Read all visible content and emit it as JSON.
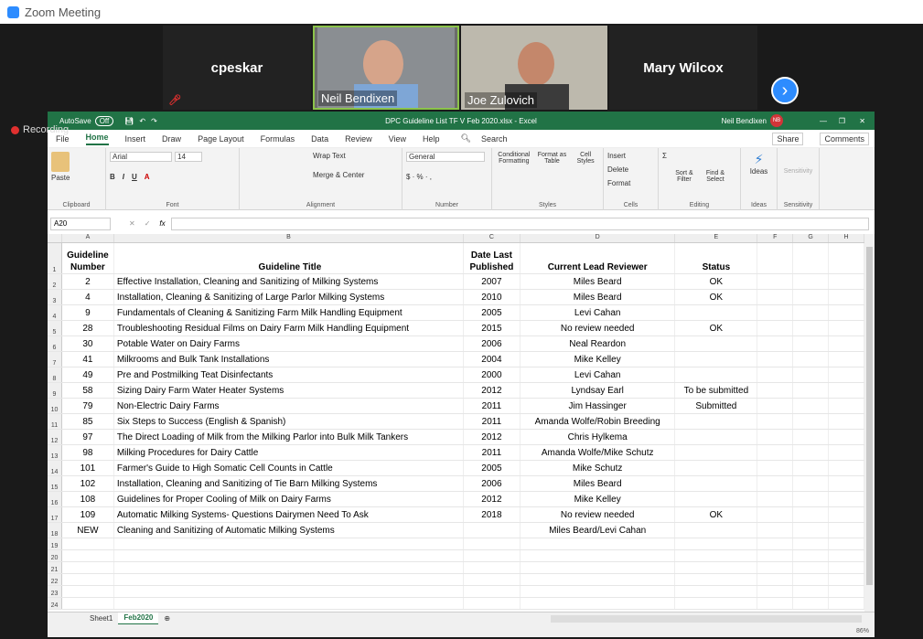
{
  "zoom": {
    "window_title": "Zoom Meeting",
    "participants": [
      {
        "name": "cpeskar",
        "muted": true,
        "video": false
      },
      {
        "name": "Neil Bendixen",
        "muted": false,
        "video": true
      },
      {
        "name": "Joe Zulovich",
        "muted": true,
        "video": true
      },
      {
        "name": "Mary Wilcox",
        "muted": false,
        "video": false
      }
    ],
    "recording_label": "Recording"
  },
  "excel": {
    "autosave": "AutoSave",
    "autosave_state": "Off",
    "file_title": "DPC Guideline List TF V Feb 2020.xlsx  -  Excel",
    "user": "Neil Bendixen",
    "user_initials": "NB",
    "menu": [
      "File",
      "Home",
      "Insert",
      "Draw",
      "Page Layout",
      "Formulas",
      "Data",
      "Review",
      "View",
      "Help"
    ],
    "search": "Search",
    "share": "Share",
    "comments": "Comments",
    "font_name": "Arial",
    "font_size": "14",
    "number_format": "General",
    "name_box": "A20",
    "ribbon_groups": [
      "Clipboard",
      "Font",
      "Alignment",
      "Number",
      "Styles",
      "Cells",
      "Editing",
      "Ideas",
      "Sensitivity"
    ],
    "ribbon_buttons": {
      "paste": "Paste",
      "wrap_text": "Wrap Text",
      "merge_center": "Merge & Center",
      "conditional": "Conditional Formatting",
      "format_table": "Format as Table",
      "cell_styles": "Cell Styles",
      "insert": "Insert",
      "delete": "Delete",
      "format": "Format",
      "sort": "Sort & Filter",
      "find": "Find & Select",
      "ideas": "Ideas",
      "sensitivity": "Sensitivity"
    },
    "columns": [
      "A",
      "B",
      "C",
      "D",
      "E",
      "F",
      "G",
      "H"
    ],
    "header": {
      "a": "Guideline Number",
      "b": "Guideline Title",
      "c": "Date Last Published",
      "d": "Current Lead Reviewer",
      "e": "Status"
    },
    "rows": [
      {
        "n": "2",
        "t": "Effective Installation, Cleaning and Sanitizing of Milking Systems",
        "y": "2007",
        "r": "Miles Beard",
        "s": "OK"
      },
      {
        "n": "4",
        "t": "Installation, Cleaning & Sanitizing of Large Parlor Milking Systems",
        "y": "2010",
        "r": "Miles Beard",
        "s": "OK"
      },
      {
        "n": "9",
        "t": "Fundamentals of Cleaning & Sanitizing Farm Milk Handling Equipment",
        "y": "2005",
        "r": "Levi Cahan",
        "s": ""
      },
      {
        "n": "28",
        "t": "Troubleshooting Residual Films on Dairy Farm Milk Handling Equipment",
        "y": "2015",
        "r": "No review needed",
        "s": "OK"
      },
      {
        "n": "30",
        "t": "Potable Water on Dairy Farms",
        "y": "2006",
        "r": "Neal Reardon",
        "s": ""
      },
      {
        "n": "41",
        "t": "Milkrooms and Bulk Tank Installations",
        "y": "2004",
        "r": "Mike Kelley",
        "s": ""
      },
      {
        "n": "49",
        "t": "Pre and Postmilking Teat Disinfectants",
        "y": "2000",
        "r": "Levi Cahan",
        "s": ""
      },
      {
        "n": "58",
        "t": "Sizing Dairy Farm Water Heater Systems",
        "y": "2012",
        "r": "Lyndsay Earl",
        "s": "To be submitted"
      },
      {
        "n": "79",
        "t": "Non-Electric Dairy Farms",
        "y": "2011",
        "r": "Jim Hassinger",
        "s": "Submitted"
      },
      {
        "n": "85",
        "t": "Six Steps to Success (English & Spanish)",
        "y": "2011",
        "r": "Amanda Wolfe/Robin Breeding",
        "s": ""
      },
      {
        "n": "97",
        "t": "The Direct Loading of Milk from the Milking Parlor into Bulk Milk Tankers",
        "y": "2012",
        "r": "Chris Hylkema",
        "s": ""
      },
      {
        "n": "98",
        "t": "Milking Procedures for Dairy Cattle",
        "y": "2011",
        "r": "Amanda Wolfe/Mike Schutz",
        "s": ""
      },
      {
        "n": "101",
        "t": "Farmer's Guide to High Somatic Cell Counts in Cattle",
        "y": "2005",
        "r": "Mike Schutz",
        "s": ""
      },
      {
        "n": "102",
        "t": "Installation, Cleaning and Sanitizing of Tie Barn Milking Systems",
        "y": "2006",
        "r": "Miles Beard",
        "s": ""
      },
      {
        "n": "108",
        "t": "Guidelines for Proper Cooling of Milk on Dairy Farms",
        "y": "2012",
        "r": "Mike Kelley",
        "s": ""
      },
      {
        "n": "109",
        "t": "Automatic Milking Systems- Questions Dairymen Need To Ask",
        "y": "2018",
        "r": "No review needed",
        "s": "OK"
      },
      {
        "n": "NEW",
        "t": "Cleaning and Sanitizing of Automatic Milking Systems",
        "y": "",
        "r": "Miles Beard/Levi Cahan",
        "s": ""
      }
    ],
    "empty_rows": [
      "19",
      "20",
      "21",
      "22",
      "23",
      "24"
    ],
    "sheets": [
      "Sheet1",
      "Feb2020"
    ],
    "active_sheet": "Feb2020",
    "zoom_level": "86%"
  }
}
